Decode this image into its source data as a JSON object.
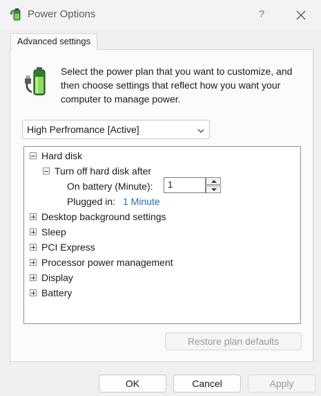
{
  "window": {
    "title": "Power Options",
    "help_glyph": "?"
  },
  "tab": {
    "label": "Advanced settings"
  },
  "intro_text": "Select the power plan that you want to customize, and then choose settings that reflect how you want your computer to manage power.",
  "plan_select": {
    "selected": "High Perfromance [Active]"
  },
  "tree": {
    "hard_disk": "Hard disk",
    "turn_off": "Turn off hard disk after",
    "on_battery_label": "On battery (Minute):",
    "on_battery_value": "1",
    "plugged_in_label": "Plugged in:",
    "plugged_in_value": "1 Minute",
    "collapsed": [
      "Desktop background settings",
      "Sleep",
      "PCI Express",
      "Processor power management",
      "Display",
      "Battery"
    ]
  },
  "buttons": {
    "restore": "Restore plan defaults",
    "ok": "OK",
    "cancel": "Cancel",
    "apply": "Apply"
  },
  "icons": {
    "window": "power-options-icon",
    "help": "help-icon",
    "close": "close-icon",
    "battery": "battery-plug-icon",
    "dropdown": "chevron-down-icon"
  }
}
